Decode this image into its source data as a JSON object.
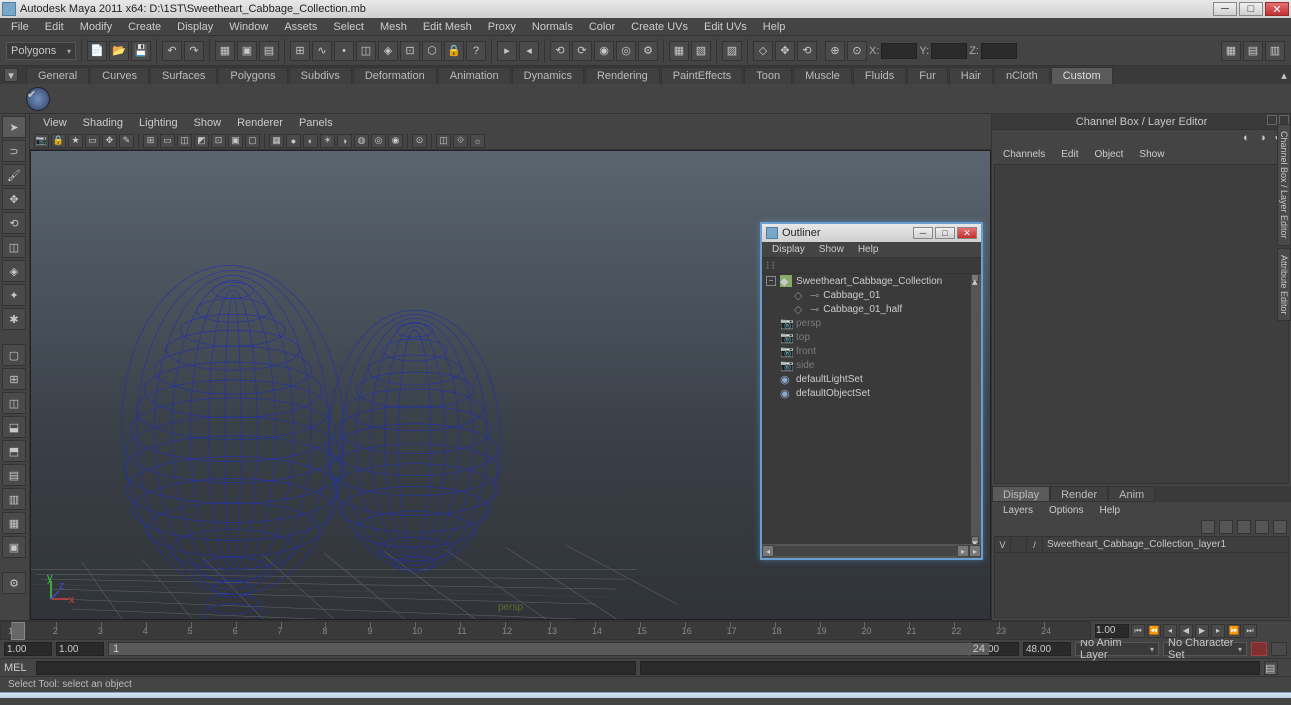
{
  "title": "Autodesk Maya 2011 x64: D:\\1ST\\Sweetheart_Cabbage_Collection.mb",
  "menubar": [
    "File",
    "Edit",
    "Modify",
    "Create",
    "Display",
    "Window",
    "Assets",
    "Select",
    "Mesh",
    "Edit Mesh",
    "Proxy",
    "Normals",
    "Color",
    "Create UVs",
    "Edit UVs",
    "Help"
  ],
  "module_dropdown": "Polygons",
  "xyz_labels": [
    "X:",
    "Y:",
    "Z:"
  ],
  "shelf_tabs": [
    "General",
    "Curves",
    "Surfaces",
    "Polygons",
    "Subdivs",
    "Deformation",
    "Animation",
    "Dynamics",
    "Rendering",
    "PaintEffects",
    "Toon",
    "Muscle",
    "Fluids",
    "Fur",
    "Hair",
    "nCloth",
    "Custom"
  ],
  "shelf_active": "Custom",
  "viewport_menubar": [
    "View",
    "Shading",
    "Lighting",
    "Show",
    "Renderer",
    "Panels"
  ],
  "viewport_label": "persp",
  "right_panel": {
    "title": "Channel Box / Layer Editor",
    "channel_menu": [
      "Channels",
      "Edit",
      "Object",
      "Show"
    ],
    "vtabs": [
      "Channel Box / Layer Editor",
      "Attribute Editor"
    ],
    "layer_tabs": [
      "Display",
      "Render",
      "Anim"
    ],
    "layer_active": "Display",
    "layer_menu": [
      "Layers",
      "Options",
      "Help"
    ],
    "layer_row": {
      "v": "V",
      "slash": "/",
      "name": "Sweetheart_Cabbage_Collection_layer1"
    }
  },
  "outliner": {
    "title": "Outliner",
    "menu": [
      "Display",
      "Show",
      "Help"
    ],
    "tree": {
      "root": "Sweetheart_Cabbage_Collection",
      "children": [
        "Cabbage_01",
        "Cabbage_01_half"
      ],
      "cameras": [
        "persp",
        "top",
        "front",
        "side"
      ],
      "sets": [
        "defaultLightSet",
        "defaultObjectSet"
      ]
    }
  },
  "timeline": {
    "ticks": [
      "1",
      "2",
      "3",
      "4",
      "5",
      "6",
      "7",
      "8",
      "9",
      "10",
      "11",
      "12",
      "13",
      "14",
      "15",
      "16",
      "17",
      "18",
      "19",
      "20",
      "21",
      "22",
      "23",
      "24"
    ],
    "current": "1.00",
    "range_start": "1.00",
    "range_inner_start": "1",
    "range_inner_end": "24",
    "range_end_a": "24.00",
    "range_end_b": "48.00",
    "anim_layer": "No Anim Layer",
    "char_set": "No Character Set"
  },
  "cmd_label": "MEL",
  "help_line": "Select Tool: select an object"
}
